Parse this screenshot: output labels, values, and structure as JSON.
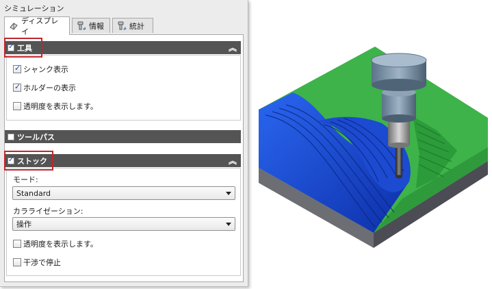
{
  "panel": {
    "title": "シミュレーション",
    "tabs": [
      {
        "label": "ディスプレイ",
        "icon": "display-icon"
      },
      {
        "label": "情報",
        "icon": "tool-info-icon"
      },
      {
        "label": "統計",
        "icon": "tool-stats-icon"
      }
    ]
  },
  "tool_section": {
    "label": "工具",
    "checked": true,
    "options": [
      {
        "label": "シャンク表示",
        "checked": true
      },
      {
        "label": "ホルダーの表示",
        "checked": true
      },
      {
        "label": "透明度を表示します。",
        "checked": false
      }
    ]
  },
  "toolpath_section": {
    "label": "ツールパス",
    "checked": false
  },
  "stock_section": {
    "label": "ストック",
    "checked": true,
    "mode_label": "モード:",
    "mode_value": "Standard",
    "colorization_label": "カラライゼーション:",
    "colorization_value": "操作",
    "options": [
      {
        "label": "透明度を表示します。",
        "checked": false
      },
      {
        "label": "干渉で停止",
        "checked": false
      }
    ]
  },
  "colors": {
    "stock_green": "#3db34a",
    "cut_blue": "#1e4fd6",
    "base_gray": "#5d5d66",
    "highlight_red": "#c0262c"
  }
}
